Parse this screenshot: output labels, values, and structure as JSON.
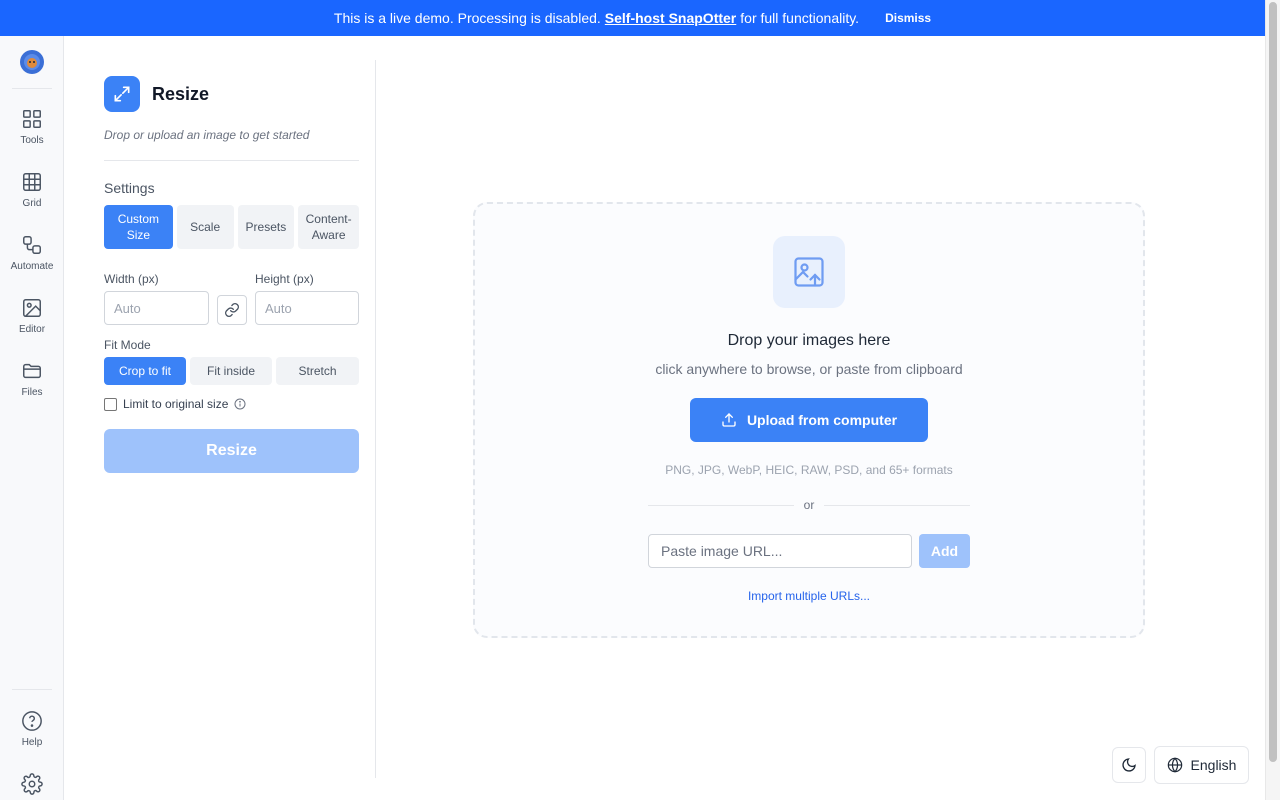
{
  "banner": {
    "text_before": "This is a live demo. Processing is disabled.",
    "link_text": "Self-host SnapOtter",
    "text_after": "for full functionality.",
    "dismiss_label": "Dismiss"
  },
  "rail": {
    "items": [
      {
        "label": "Tools",
        "icon": "grid-2x2-icon"
      },
      {
        "label": "Grid",
        "icon": "grid-3x3-icon"
      },
      {
        "label": "Automate",
        "icon": "workflow-icon"
      },
      {
        "label": "Editor",
        "icon": "image-edit-icon"
      },
      {
        "label": "Files",
        "icon": "folder-icon"
      }
    ],
    "bottom_items": [
      {
        "label": "Help",
        "icon": "help-circle-icon"
      },
      {
        "label": "",
        "icon": "gear-icon"
      }
    ]
  },
  "panel": {
    "title": "Resize",
    "subtitle": "Drop or upload an image to get started",
    "settings_label": "Settings",
    "tabs": [
      {
        "label": "Custom Size",
        "active": true
      },
      {
        "label": "Scale",
        "active": false
      },
      {
        "label": "Presets",
        "active": false
      },
      {
        "label": "Content-Aware",
        "active": false
      }
    ],
    "width_label": "Width (px)",
    "width_placeholder": "Auto",
    "height_label": "Height (px)",
    "height_placeholder": "Auto",
    "fit_mode_label": "Fit Mode",
    "fit_modes": [
      {
        "label": "Crop to fit",
        "active": true
      },
      {
        "label": "Fit inside",
        "active": false
      },
      {
        "label": "Stretch",
        "active": false
      }
    ],
    "limit_label": "Limit to original size",
    "limit_checked": false,
    "resize_button": "Resize"
  },
  "dropzone": {
    "title": "Drop your images here",
    "subtitle": "click anywhere to browse, or paste from clipboard",
    "upload_button": "Upload from computer",
    "formats": "PNG, JPG, WebP, HEIC, RAW, PSD, and 65+ formats",
    "or_text": "or",
    "url_placeholder": "Paste image URL...",
    "add_button": "Add",
    "import_link": "Import multiple URLs..."
  },
  "footer": {
    "language": "English"
  },
  "colors": {
    "banner": "#1a66ff",
    "accent": "#3b82f6",
    "disabled_accent": "#9ec2fb"
  }
}
